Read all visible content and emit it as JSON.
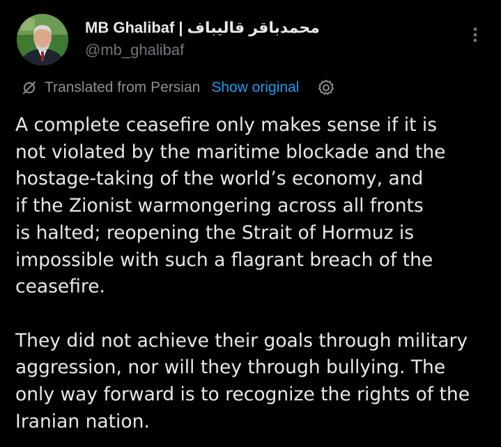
{
  "author": {
    "display_name": "MB Ghalibaf",
    "separator": "|",
    "display_name_persian": "محمدباقر قالیباف",
    "handle": "@mb_ghalibaf",
    "avatar_icon": "profile-photo",
    "avatar_bg": "#3d6e2f"
  },
  "menu": {
    "more_icon": "more-vertical-icon"
  },
  "translation": {
    "label": "Translated from Persian",
    "show_original": "Show original",
    "settings_icon": "gear-icon",
    "translate_icon": "translate-icon"
  },
  "colors": {
    "background": "#000000",
    "text": "#e7e9ea",
    "muted": "#71767b",
    "link": "#1d9bf0"
  },
  "body": {
    "paragraphs": [
      {
        "lines": [
          "A complete ceasefire only makes sense if it is",
          "not violated by the maritime blockade and the",
          "hostage-taking of the world’s economy, and",
          "if the Zionist warmongering across all fronts",
          "is halted; reopening the Strait of Hormuz is",
          "impossible with such a flagrant breach of the",
          "ceasefire."
        ]
      },
      {
        "lines": [
          "They did not achieve their goals through military",
          "aggression, nor will they through bullying. The",
          "only way forward is to recognize the rights of the",
          "Iranian nation."
        ]
      }
    ]
  }
}
